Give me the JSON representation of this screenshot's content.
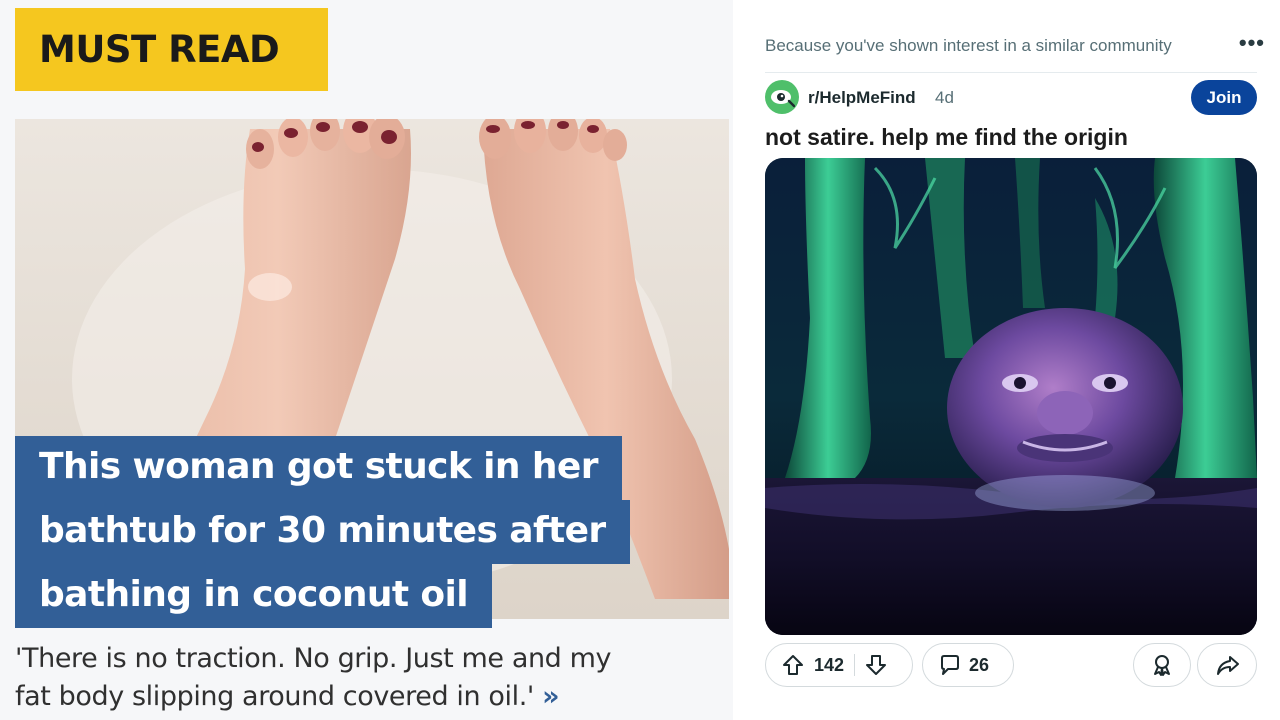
{
  "left": {
    "badge": "MUST READ",
    "headline_lines": [
      "This woman got stuck in her",
      "bathtub for 30 minutes after",
      "bathing in coconut oil"
    ],
    "quote_lines": [
      "'There is no traction. No grip. Just me and my",
      "fat body slipping around covered in oil.'"
    ],
    "quote_arrow": "»",
    "colors": {
      "badge": "#f5c71f",
      "headline_bg": "#325f97"
    }
  },
  "right": {
    "recommendation": "Because you've shown interest in a similar community",
    "more_icon": "more-options-icon",
    "subreddit": "r/HelpMeFind",
    "age": "4d",
    "join_label": "Join",
    "title": "not satire. help me find the origin",
    "upvotes": "142",
    "comments": "26",
    "icons": [
      "upvote-icon",
      "downvote-icon",
      "comment-icon",
      "award-icon",
      "share-icon"
    ],
    "colors": {
      "join": "#0a449b",
      "avatar": "#4fbf6a"
    }
  }
}
